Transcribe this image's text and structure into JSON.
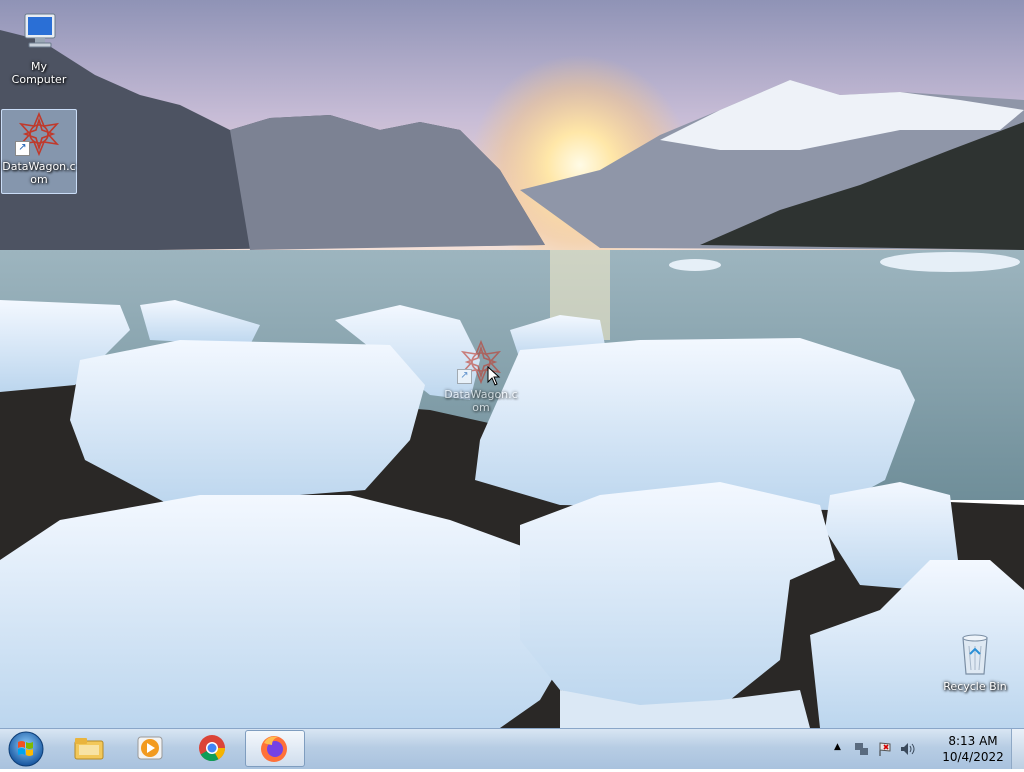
{
  "desktop": {
    "icons": [
      {
        "label": "My Computer"
      },
      {
        "label": "DataWagon.com"
      },
      {
        "label": "Recycle Bin"
      }
    ],
    "drag_ghost": {
      "label": "DataWagon.com"
    }
  },
  "taskbar": {
    "pinned": [
      {
        "name": "Windows Explorer",
        "icon": "folder-icon"
      },
      {
        "name": "Windows Media Player",
        "icon": "media-player-icon"
      },
      {
        "name": "Google Chrome",
        "icon": "chrome-icon"
      },
      {
        "name": "Mozilla Firefox",
        "icon": "firefox-icon",
        "active": true
      }
    ],
    "clock": {
      "time": "8:13 AM",
      "date": "10/4/2022"
    }
  },
  "colors": {
    "taskbar": "#b7cde4",
    "datawagon_logo": "#c0392b"
  }
}
